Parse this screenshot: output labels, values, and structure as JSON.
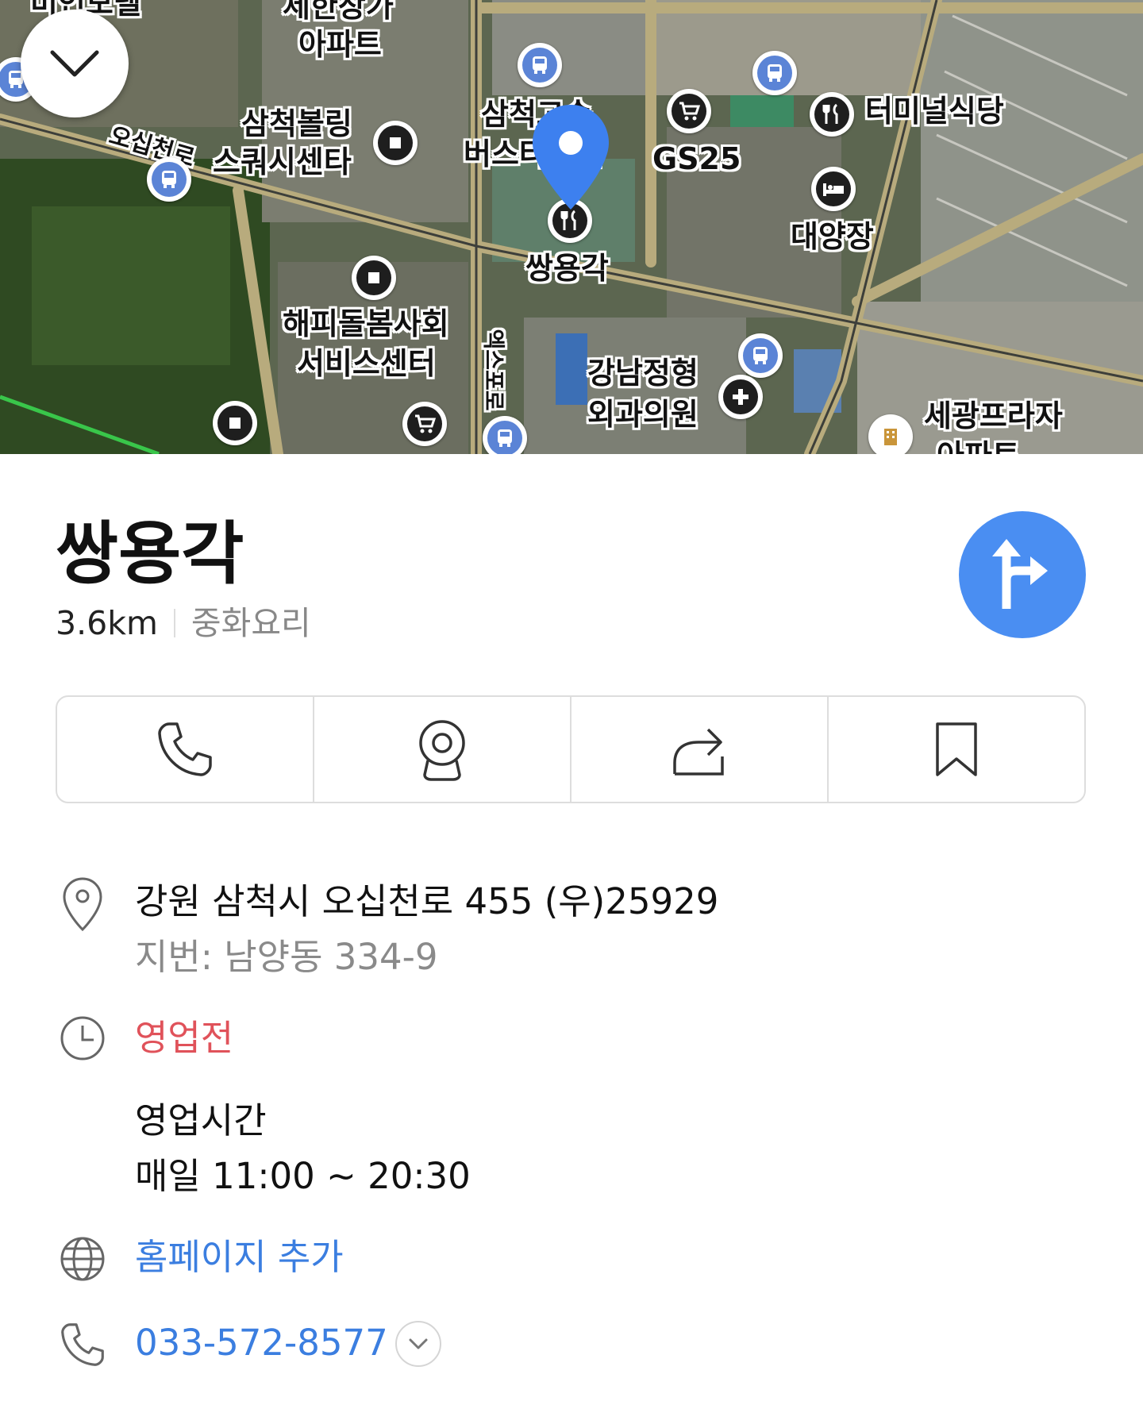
{
  "map": {
    "labels": {
      "l1": "세한장가",
      "l2": "아파트",
      "l3": "삼척볼링",
      "l4": "스쿼시센타",
      "l5": "삼척고속",
      "l6": "버스터미널",
      "l7": "GS25",
      "l8": "터미널식당",
      "l9": "대양장",
      "l10": "쌍용각",
      "l11": "해피돌봄사회",
      "l12": "서비스센터",
      "l13": "강남정형",
      "l14": "외과의원",
      "l15": "세광프라자",
      "l16": "아파트",
      "l17": "오십천로",
      "l18": "엑스포로",
      "l19": "미인모텔"
    },
    "icons": {
      "collapse": "chevron-down-icon",
      "pin": "location-pin-icon"
    }
  },
  "place": {
    "name": "쌍용각",
    "distance": "3.6km",
    "category": "중화요리"
  },
  "actions": [
    {
      "name": "call",
      "icon": "phone-icon"
    },
    {
      "name": "roadview",
      "icon": "camera-icon"
    },
    {
      "name": "share",
      "icon": "share-icon"
    },
    {
      "name": "save",
      "icon": "bookmark-icon"
    }
  ],
  "details": {
    "address": "강원 삼척시 오십천로 455 (우)25929",
    "jibun": "지번: 남양동 334-9",
    "status": "영업전",
    "hours_title": "영업시간",
    "hours_value": "매일 11:00 ~ 20:30",
    "homepage": "홈페이지 추가",
    "phone": "033-572-8577"
  },
  "colors": {
    "accent": "#4a8ef2",
    "status_red": "#e0525a",
    "link_blue": "#3b7ee0"
  }
}
